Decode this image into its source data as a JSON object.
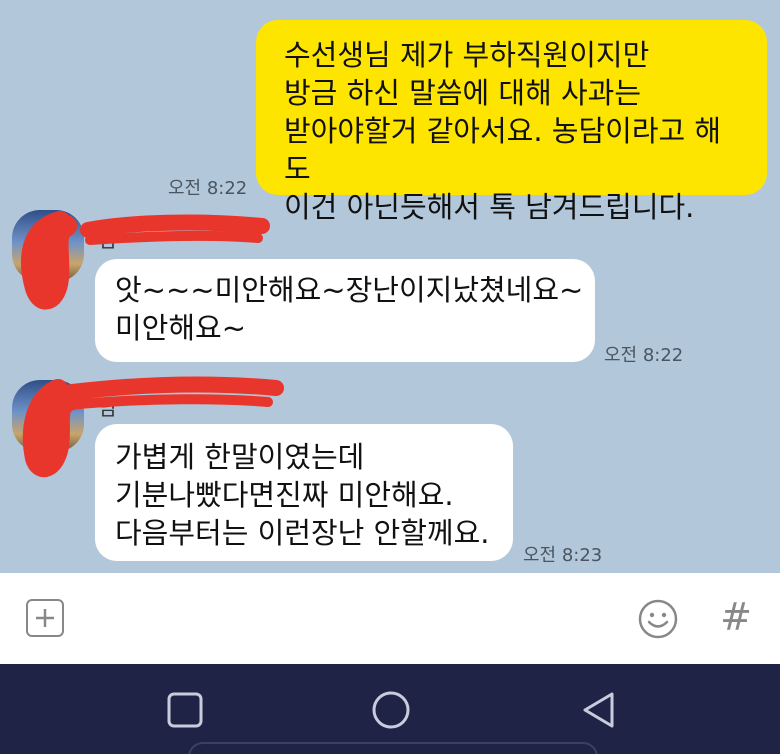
{
  "messages": [
    {
      "sender": "me",
      "text": "수선생님 제가 부하직원이지만\n방금 하신 말씀에 대해 사과는\n받아야할거 같아서요. 농담이라고 해도\n이건 아닌듯해서 톡 남겨드립니다.",
      "time": "오전 8:22"
    },
    {
      "sender": "other",
      "name": "님",
      "text": "앗~~~미안해요~장난이지났쳤네요~\n미안해요~",
      "time": "오전 8:22"
    },
    {
      "sender": "other",
      "name": "님",
      "text": "가볍게 한말이였는데\n기분나빴다면진짜 미안해요.\n다음부터는 이런장난 안할께요.",
      "time": "오전 8:23"
    }
  ],
  "input_bar": {
    "add_icon": "plus-square-icon",
    "emoji_icon": "smiley-icon",
    "hash_label": "#"
  },
  "nav_bar": {
    "recents_icon": "square-icon",
    "home_icon": "circle-icon",
    "back_icon": "triangle-back-icon"
  },
  "colors": {
    "chat_background": "#b2c7d9",
    "my_bubble": "#fee500",
    "their_bubble": "#ffffff",
    "nav_bar": "#1f2447",
    "redaction": "#e8362c"
  }
}
